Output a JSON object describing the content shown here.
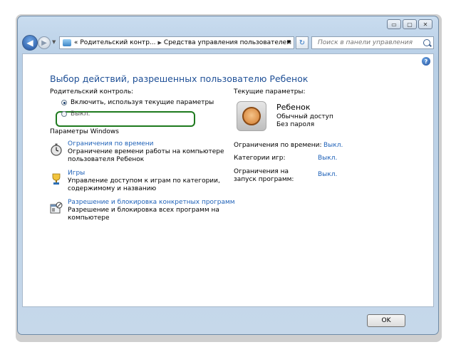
{
  "window": {
    "controls": {
      "minimize": "▭",
      "maximize": "▢",
      "close": "✕"
    }
  },
  "nav": {
    "back_icon": "◀",
    "forward_icon": "▶",
    "address": {
      "prefix": "«",
      "crumbs": [
        "Родительский контр...",
        "Средства управления пользователем"
      ],
      "separator": "▶",
      "dropdown_icon": "▼"
    },
    "refresh_icon": "↻",
    "search": {
      "placeholder": "Поиск в панели управления"
    }
  },
  "help_icon": "?",
  "page": {
    "title": "Выбор действий, разрешенных пользователю Ребенок",
    "parental_control_label": "Родительский контроль:",
    "radio_on": "Включить, используя текущие параметры",
    "radio_off": "Выкл.",
    "windows_settings_label": "Параметры Windows",
    "options": [
      {
        "link": "Ограничения по времени",
        "desc": "Ограничение времени работы на компьютере пользователя Ребенок",
        "icon": "clock-icon"
      },
      {
        "link": "Игры",
        "desc": "Управление доступом к играм по категории, содержимому и названию",
        "icon": "trophy-icon"
      },
      {
        "link": "Разрешение и блокировка конкретных программ",
        "desc": "Разрешение и блокировка всех программ на компьютере",
        "icon": "program-block-icon"
      }
    ],
    "current": {
      "label": "Текущие параметры:",
      "user_name": "Ребенок",
      "user_type": "Обычный доступ",
      "user_password": "Без пароля",
      "rows": [
        {
          "label": "Ограничения по времени:",
          "value": "Выкл."
        },
        {
          "label": "Категории игр:",
          "value": "Выкл."
        },
        {
          "label": "Ограничения на запуск программ:",
          "value": "Выкл."
        }
      ]
    }
  },
  "footer": {
    "ok_label": "OK"
  },
  "colors": {
    "link": "#1e61b8",
    "title": "#1e4f96",
    "highlight": "#1e7a1e"
  }
}
